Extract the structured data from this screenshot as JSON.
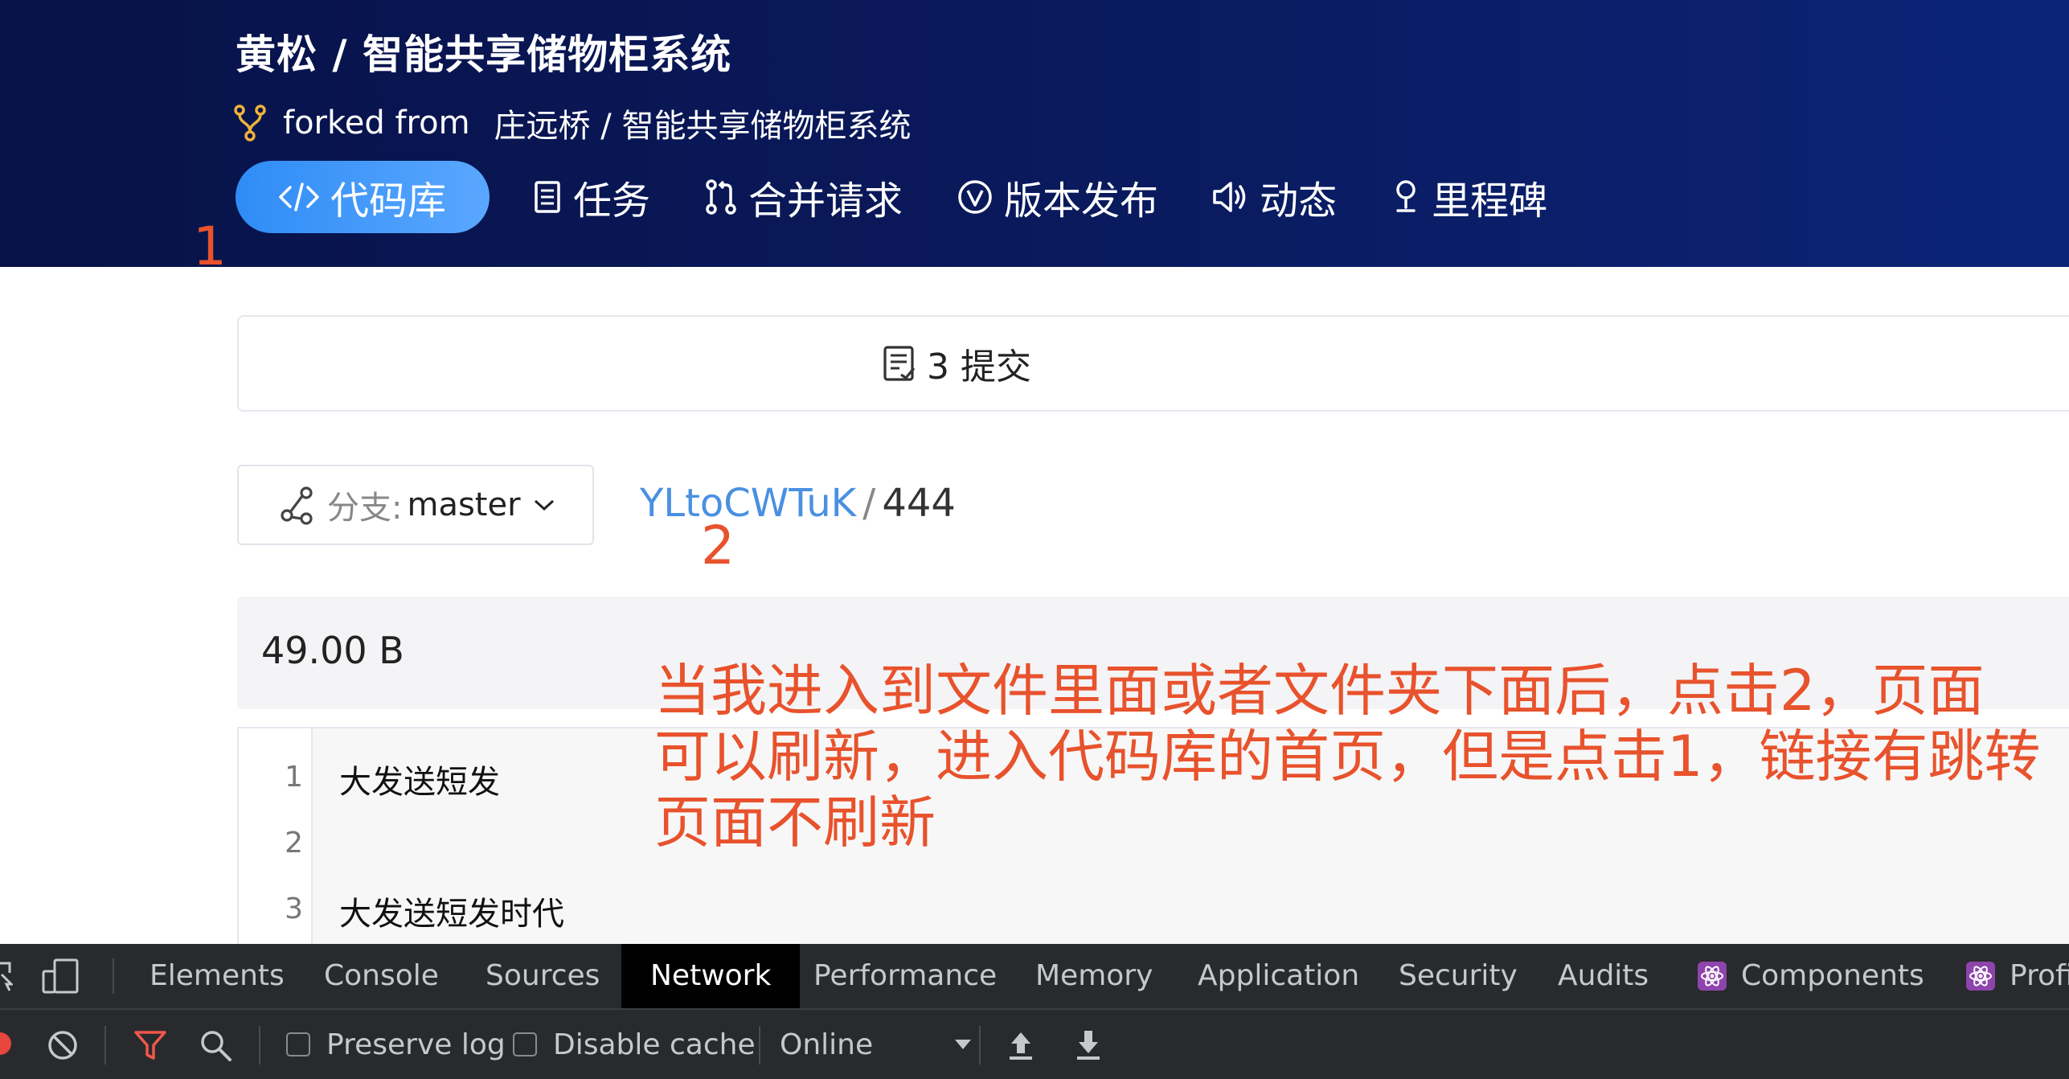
{
  "header": {
    "title": "黄松 / 智能共享储物柜系统",
    "fork_prefix": "forked from",
    "fork_source": "庄远桥 / 智能共享储物柜系统",
    "tabs": [
      {
        "label": "代码库",
        "icon": "code-icon",
        "active": true
      },
      {
        "label": "任务",
        "icon": "task-icon"
      },
      {
        "label": "合并请求",
        "icon": "merge-request-icon"
      },
      {
        "label": "版本发布",
        "icon": "release-icon"
      },
      {
        "label": "动态",
        "icon": "speaker-icon"
      },
      {
        "label": "里程碑",
        "icon": "milestone-icon"
      }
    ]
  },
  "annotations": {
    "label_1": "1",
    "label_2": "2",
    "note_lines": [
      "当我进入到文件里面或者文件夹下面后，点击2，页面",
      "可以刷新，进入代码库的首页，但是点击1，链接有跳转",
      "页面不刷新"
    ],
    "color": "#e8522c"
  },
  "commits": {
    "label": "3 提交",
    "icon": "commit-icon"
  },
  "branch": {
    "prefix": "分支:",
    "name": "master",
    "icon": "branch-icon"
  },
  "breadcrumb": {
    "link": "YLtoCWTuK",
    "separator": "/",
    "file": "444"
  },
  "file": {
    "size": "49.00 B",
    "lines": [
      {
        "num": "1",
        "text": "大发送短发"
      },
      {
        "num": "2",
        "text": ""
      },
      {
        "num": "3",
        "text": "大发送短发时代"
      }
    ]
  },
  "devtools": {
    "tabs": [
      "Elements",
      "Console",
      "Sources",
      "Network",
      "Performance",
      "Memory",
      "Application",
      "Security",
      "Audits",
      "Components",
      "Profi"
    ],
    "active_tab": "Network",
    "toolbar": {
      "preserve_log": "Preserve log",
      "disable_cache": "Disable cache",
      "throttle": "Online"
    }
  },
  "colors": {
    "header_bg": "#0a1a5e",
    "active_tab": "#3f98f8",
    "link": "#4a90e2"
  }
}
